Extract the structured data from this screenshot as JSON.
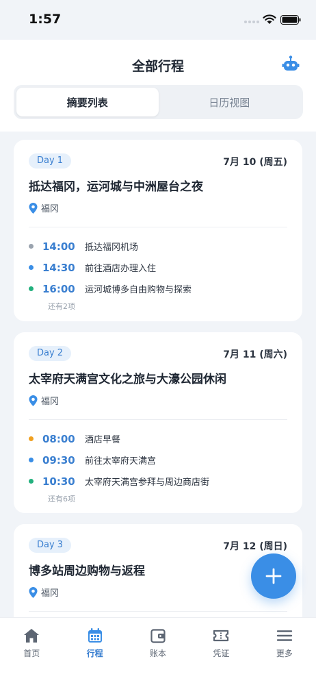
{
  "status_bar": {
    "time": "1:57"
  },
  "header": {
    "title": "全部行程",
    "robot_icon": "robot-icon"
  },
  "view_tabs": [
    {
      "label": "摘要列表",
      "active": true
    },
    {
      "label": "日历视图",
      "active": false
    }
  ],
  "days": [
    {
      "badge": "Day 1",
      "date": "7月 10 (周五)",
      "title": "抵达福冈，运河城与中洲屋台之夜",
      "location": "福冈",
      "items": [
        {
          "time": "14:00",
          "text": "抵达福冈机场",
          "dot_color": "#9aa3ae"
        },
        {
          "time": "14:30",
          "text": "前往酒店办理入住",
          "dot_color": "#3a8ee6"
        },
        {
          "time": "16:00",
          "text": "运河城博多自由购物与探索",
          "dot_color": "#22b07d"
        }
      ],
      "more": "还有2项"
    },
    {
      "badge": "Day 2",
      "date": "7月 11 (周六)",
      "title": "太宰府天满宫文化之旅与大濠公园休闲",
      "location": "福冈",
      "items": [
        {
          "time": "08:00",
          "text": "酒店早餐",
          "dot_color": "#f0a020"
        },
        {
          "time": "09:30",
          "text": "前往太宰府天满宫",
          "dot_color": "#3a8ee6"
        },
        {
          "time": "10:30",
          "text": "太宰府天满宫参拜与周边商店街",
          "dot_color": "#22b07d"
        }
      ],
      "more": "还有6项"
    },
    {
      "badge": "Day 3",
      "date": "7月 12 (周日)",
      "title": "博多站周边购物与返程",
      "location": "福冈",
      "items": [],
      "more": ""
    }
  ],
  "fab": {
    "icon": "plus-icon"
  },
  "tabbar": [
    {
      "label": "首页",
      "icon": "home-icon",
      "active": false
    },
    {
      "label": "行程",
      "icon": "calendar-icon",
      "active": true
    },
    {
      "label": "账本",
      "icon": "wallet-icon",
      "active": false
    },
    {
      "label": "凭证",
      "icon": "ticket-icon",
      "active": false
    },
    {
      "label": "更多",
      "icon": "menu-icon",
      "active": false
    }
  ],
  "colors": {
    "accent": "#3a8ee6",
    "accent_text": "#3a7fd0",
    "background": "#f1f4f8"
  }
}
